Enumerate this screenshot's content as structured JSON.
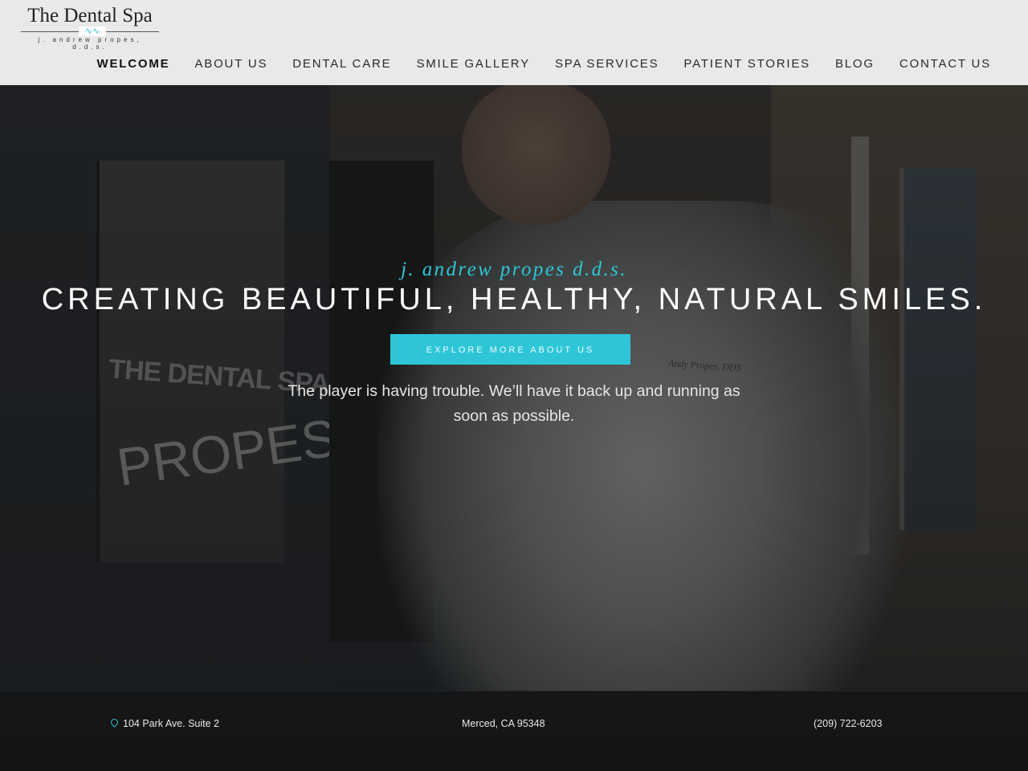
{
  "brand": {
    "title": "The Dental Spa",
    "subtitle": "j. andrew propes, d.d.s.",
    "accent_color": "#2ec6d7"
  },
  "nav": {
    "items": [
      {
        "label": "WELCOME",
        "active": true
      },
      {
        "label": "ABOUT US",
        "active": false
      },
      {
        "label": "DENTAL CARE",
        "active": false
      },
      {
        "label": "SMILE GALLERY",
        "active": false
      },
      {
        "label": "SPA SERVICES",
        "active": false
      },
      {
        "label": "PATIENT STORIES",
        "active": false
      },
      {
        "label": "BLOG",
        "active": false
      },
      {
        "label": "CONTACT US",
        "active": false
      }
    ]
  },
  "hero": {
    "tagline": "j. andrew propes d.d.s.",
    "headline": "CREATING BEAUTIFUL, HEALTHY, NATURAL SMILES.",
    "cta_label": "EXPLORE MORE ABOUT US",
    "player_message": "The player is having trouble. We’ll have it back up and running as soon as possible.",
    "background_text": {
      "door_logo": "THE DENTAL SPA",
      "door_name": "PROPES",
      "coat_name": "Andy Propes, DDS"
    }
  },
  "footer": {
    "address": "104 Park Ave. Suite 2",
    "city": "Merced, CA 95348",
    "phone": "(209) 722-6203",
    "address_icon": "map-pin-icon"
  }
}
